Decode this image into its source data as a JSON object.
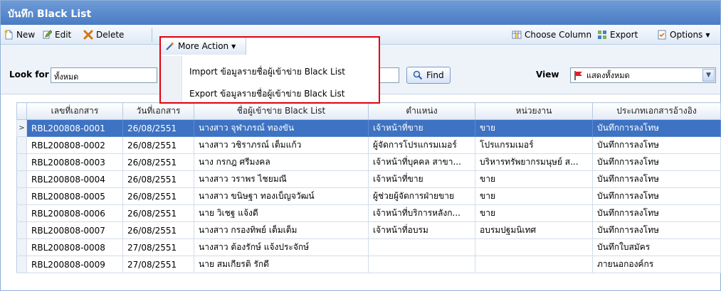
{
  "title": "บันทึก Black List",
  "toolbar": {
    "new_label": "New",
    "edit_label": "Edit",
    "delete_label": "Delete",
    "more_action_label": "More Action",
    "choose_column_label": "Choose Column",
    "export_label": "Export",
    "options_label": "Options"
  },
  "more_action_menu": [
    "Import ข้อมูลรายชื่อผู้เข้าข่าย Black List",
    "Export ข้อมูลรายชื่อผู้เข้าข่าย Black List"
  ],
  "filter": {
    "look_for_label": "Look for",
    "look_for_value": "ทั้งหมด",
    "find_label": "Find",
    "view_label": "View",
    "view_value": "แสดงทั้งหมด"
  },
  "grid": {
    "columns": [
      "เลขที่เอกสาร",
      "วันที่เอกสาร",
      "ชื่อผู้เข้าข่าย Black List",
      "ตำแหน่ง",
      "หน่วยงาน",
      "ประเภทเอกสารอ้างอิง"
    ],
    "selected_marker": ">",
    "rows": [
      [
        "RBL200808-0001",
        "26/08/2551",
        "นางสาว จุฬาภรณ์ ทองขัน",
        "เจ้าหน้าที่ขาย",
        "ขาย",
        "บันทึกการลงโทษ"
      ],
      [
        "RBL200808-0002",
        "26/08/2551",
        "นางสาว วชิราภรณ์ เต็มแก้ว",
        "ผู้จัดการโปรแกรมเมอร์",
        "โปรแกรมเมอร์",
        "บันทึกการลงโทษ"
      ],
      [
        "RBL200808-0003",
        "26/08/2551",
        "นาง กรกฎ ศรีมงคล",
        "เจ้าหน้าที่บุคคล สาขา...",
        "บริหารทรัพยากรมนุษย์ ส...",
        "บันทึกการลงโทษ"
      ],
      [
        "RBL200808-0004",
        "26/08/2551",
        "นางสาว วราพร ไชยมณี",
        "เจ้าหน้าที่ขาย",
        "ขาย",
        "บันทึกการลงโทษ"
      ],
      [
        "RBL200808-0005",
        "26/08/2551",
        "นางสาว ขนิษฐา ทองเบ็ญจวัฒน์",
        "ผู้ช่วยผู้จัดการฝ่ายขาย",
        "ขาย",
        "บันทึกการลงโทษ"
      ],
      [
        "RBL200808-0006",
        "26/08/2551",
        "นาย วิเชฐ แจ้งดี",
        "เจ้าหน้าที่บริการหลังก...",
        "ขาย",
        "บันทึกการลงโทษ"
      ],
      [
        "RBL200808-0007",
        "26/08/2551",
        "นางสาว กรองทิพย์ เต็มเต็ม",
        "เจ้าหน้าที่อบรม",
        "อบรมปฐมนิเทศ",
        "บันทึกการลงโทษ"
      ],
      [
        "RBL200808-0008",
        "27/08/2551",
        "นางสาว ต้องรักษ์ แจ้งประจักษ์",
        "",
        "",
        "บันทึกใบสมัคร"
      ],
      [
        "RBL200808-0009",
        "27/08/2551",
        "นาย สมเกียรติ รักดี",
        "",
        "",
        "ภายนอกองค์กร"
      ]
    ]
  },
  "colors": {
    "titlebar": "#4a7cc4",
    "selected_row": "#3e72c2",
    "highlight_border": "#e0000f"
  }
}
